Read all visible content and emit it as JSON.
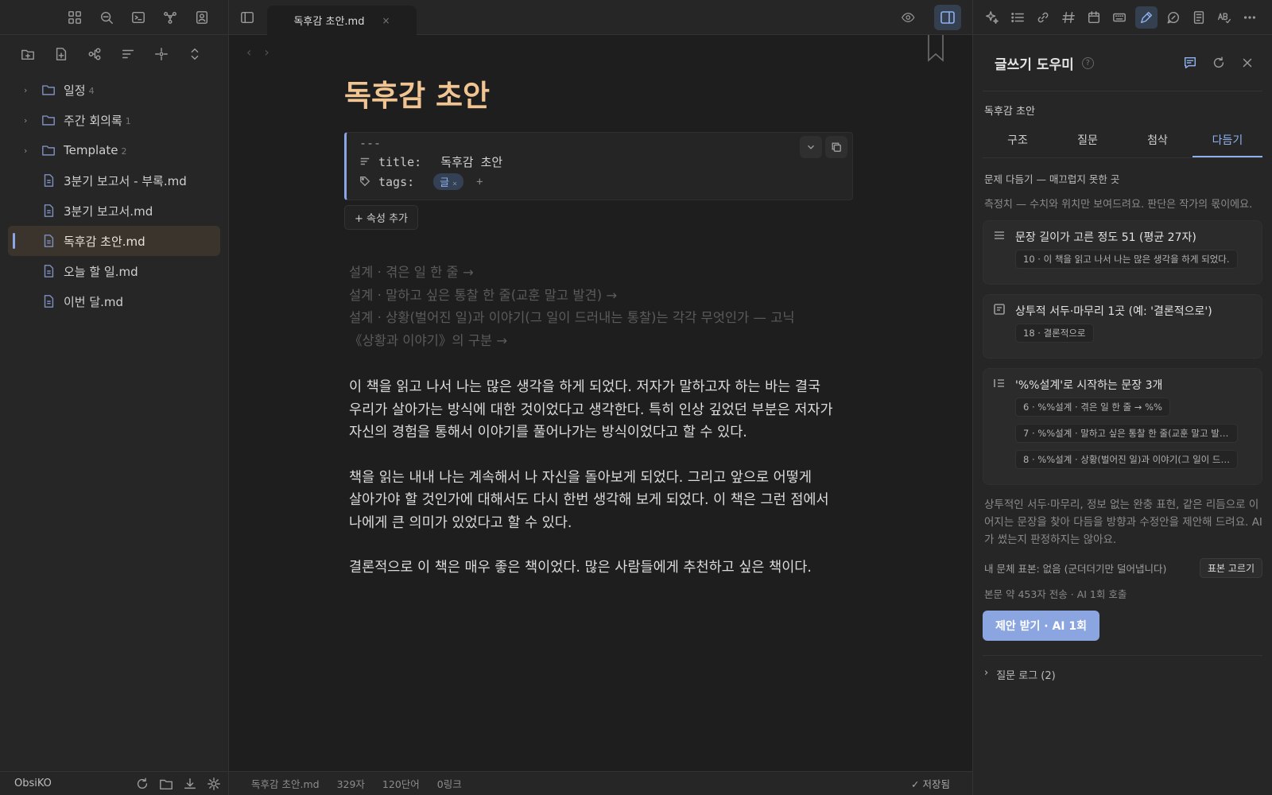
{
  "sidebar": {
    "vault_name": "ObsiKO",
    "tree": [
      {
        "type": "folder",
        "label": "일정",
        "count": "4"
      },
      {
        "type": "folder",
        "label": "주간 회의록",
        "count": "1"
      },
      {
        "type": "folder",
        "label": "Template",
        "count": "2"
      },
      {
        "type": "file",
        "label": "3분기 보고서 - 부록.md"
      },
      {
        "type": "file",
        "label": "3분기 보고서.md"
      },
      {
        "type": "file",
        "label": "독후감 초안.md",
        "active": true
      },
      {
        "type": "file",
        "label": "오늘 할 일.md"
      },
      {
        "type": "file",
        "label": "이번 달.md"
      }
    ]
  },
  "editor": {
    "tab_title": "독후감 초안.md",
    "doc_title": "독후감 초안",
    "frontmatter": {
      "dashes": "---",
      "title_key": "title:",
      "title_value": "독후감 초안",
      "tags_key": "tags:",
      "tag": "글",
      "tag_remove": "×",
      "tag_add": "+"
    },
    "add_property": "+ 속성 추가",
    "ghost_lines": [
      "설계 · 겪은 일 한 줄 →",
      "설계 · 말하고 싶은 통찰 한 줄(교훈 말고 발견) →",
      "설계 · 상황(벌어진 일)과 이야기(그 일이 드러내는 통찰)는 각각 무엇인가 — 고닉",
      "《상황과 이야기》의 구분 →"
    ],
    "paragraphs": [
      "이 책을 읽고 나서 나는 많은 생각을 하게 되었다. 저자가 말하고자 하는 바는 결국\n우리가 살아가는 방식에 대한 것이었다고 생각한다. 특히 인상 깊었던 부분은 저자가\n자신의 경험을 통해서 이야기를 풀어나가는 방식이었다고 할 수 있다.",
      "책을 읽는 내내 나는 계속해서 나 자신을 돌아보게 되었다. 그리고 앞으로 어떻게\n살아가야 할 것인가에 대해서도 다시 한번 생각해 보게 되었다. 이 책은 그런 점에서\n나에게 큰 의미가 있었다고 할 수 있다.",
      "결론적으로 이 책은 매우 좋은 책이었다. 많은 사람들에게 추천하고 싶은 책이다."
    ],
    "status": {
      "file": "독후감 초안.md",
      "chars": "329자",
      "words": "120단어",
      "links": "0링크",
      "saved": "✓ 저장됨"
    }
  },
  "panel": {
    "title": "글쓰기 도우미",
    "help": "?",
    "doc_name": "독후감 초안",
    "tabs": [
      "구조",
      "질문",
      "첨삭",
      "다듬기"
    ],
    "active_tab": "다듬기",
    "section_title": "문제 다듬기 — 매끄럽지 못한 곳",
    "note": "측정치 — 수치와 위치만 보여드려요. 판단은 작가의 몫이에요.",
    "cards": [
      {
        "icon": "lines-icon",
        "title": "문장 길이가 고른 정도 51 (평균 27자)",
        "chips": [
          "10 · 이 책을 읽고 나서 나는 많은 생각을 하게 되었다."
        ]
      },
      {
        "icon": "quote-box-icon",
        "title": "상투적 서두·마무리 1곳 (예: '결론적으로')",
        "chips": [
          "18 · 결론적으로"
        ]
      },
      {
        "icon": "list-icon",
        "title": "'%%설계'로 시작하는 문장 3개",
        "chips": [
          "6 · %%설계 · 겪은 일 한 줄 → %%",
          "7 · %%설계 · 말하고 싶은 통찰 한 줄(교훈 말고 발견...",
          "8 · %%설계 · 상황(벌어진 일)과 이야기(그 일이 드러..."
        ]
      }
    ],
    "description": "상투적인 서두·마무리, 정보 없는 완충 표현, 같은 리듬으로 이어지는 문장을 찾아 다듬을 방향과 수정안을 제안해 드려요. AI가 썼는지 판정하지는 않아요.",
    "sample_label": "내 문체 표본: 없음 (군더더기만 덜어냅니다)",
    "sample_button": "표본 고르기",
    "cost": "본문 약 453자 전송 · AI 1회 호출",
    "submit": "제안 받기 · AI 1회",
    "log": "질문 로그 (2)",
    "log_chevron": "›"
  },
  "colors": {
    "accent": "#8fb0ef",
    "title": "#f0c493",
    "button": "#8aa5e0"
  }
}
